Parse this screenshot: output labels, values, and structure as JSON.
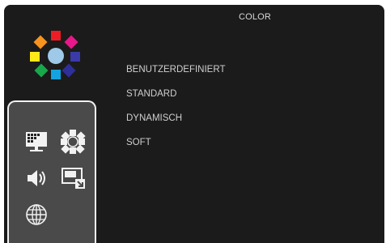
{
  "osd": {
    "title": "COLOR",
    "menu_items": [
      {
        "label": "BENUTZERDEFINIERT"
      },
      {
        "label": "STANDARD"
      },
      {
        "label": "DYNAMISCH"
      },
      {
        "label": "SOFT"
      }
    ]
  },
  "icons": [
    "color-logo-icon",
    "picture-icon",
    "color-icon",
    "audio-icon",
    "input-source-icon",
    "language-icon"
  ],
  "colors": {
    "background": "#1b1b1b",
    "text": "#cfcfcf",
    "panel": "#4a4a4a",
    "panel_border": "#f2f2f2"
  }
}
